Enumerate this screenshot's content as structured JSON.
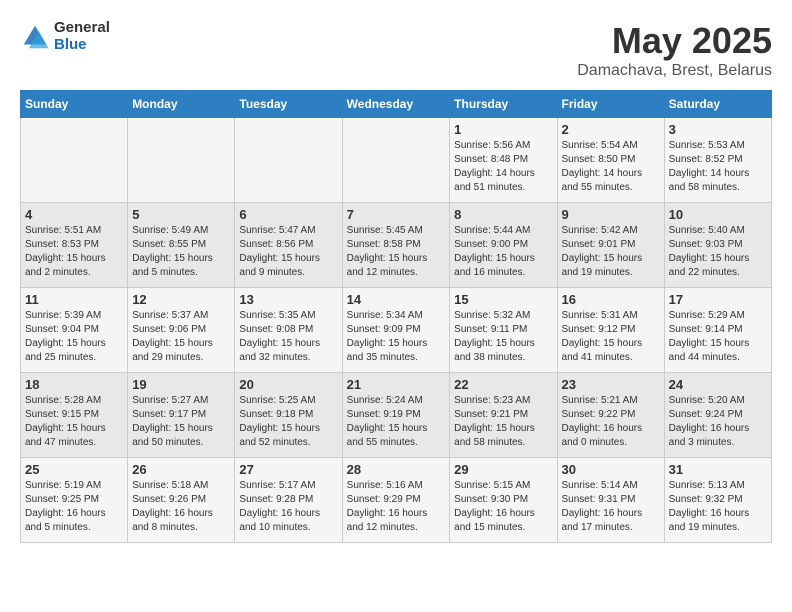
{
  "logo": {
    "general": "General",
    "blue": "Blue"
  },
  "title": "May 2025",
  "subtitle": "Damachava, Brest, Belarus",
  "headers": [
    "Sunday",
    "Monday",
    "Tuesday",
    "Wednesday",
    "Thursday",
    "Friday",
    "Saturday"
  ],
  "weeks": [
    [
      {
        "day": "",
        "sunrise": "",
        "sunset": "",
        "daylight": ""
      },
      {
        "day": "",
        "sunrise": "",
        "sunset": "",
        "daylight": ""
      },
      {
        "day": "",
        "sunrise": "",
        "sunset": "",
        "daylight": ""
      },
      {
        "day": "",
        "sunrise": "",
        "sunset": "",
        "daylight": ""
      },
      {
        "day": "1",
        "sunrise": "Sunrise: 5:56 AM",
        "sunset": "Sunset: 8:48 PM",
        "daylight": "Daylight: 14 hours and 51 minutes."
      },
      {
        "day": "2",
        "sunrise": "Sunrise: 5:54 AM",
        "sunset": "Sunset: 8:50 PM",
        "daylight": "Daylight: 14 hours and 55 minutes."
      },
      {
        "day": "3",
        "sunrise": "Sunrise: 5:53 AM",
        "sunset": "Sunset: 8:52 PM",
        "daylight": "Daylight: 14 hours and 58 minutes."
      }
    ],
    [
      {
        "day": "4",
        "sunrise": "Sunrise: 5:51 AM",
        "sunset": "Sunset: 8:53 PM",
        "daylight": "Daylight: 15 hours and 2 minutes."
      },
      {
        "day": "5",
        "sunrise": "Sunrise: 5:49 AM",
        "sunset": "Sunset: 8:55 PM",
        "daylight": "Daylight: 15 hours and 5 minutes."
      },
      {
        "day": "6",
        "sunrise": "Sunrise: 5:47 AM",
        "sunset": "Sunset: 8:56 PM",
        "daylight": "Daylight: 15 hours and 9 minutes."
      },
      {
        "day": "7",
        "sunrise": "Sunrise: 5:45 AM",
        "sunset": "Sunset: 8:58 PM",
        "daylight": "Daylight: 15 hours and 12 minutes."
      },
      {
        "day": "8",
        "sunrise": "Sunrise: 5:44 AM",
        "sunset": "Sunset: 9:00 PM",
        "daylight": "Daylight: 15 hours and 16 minutes."
      },
      {
        "day": "9",
        "sunrise": "Sunrise: 5:42 AM",
        "sunset": "Sunset: 9:01 PM",
        "daylight": "Daylight: 15 hours and 19 minutes."
      },
      {
        "day": "10",
        "sunrise": "Sunrise: 5:40 AM",
        "sunset": "Sunset: 9:03 PM",
        "daylight": "Daylight: 15 hours and 22 minutes."
      }
    ],
    [
      {
        "day": "11",
        "sunrise": "Sunrise: 5:39 AM",
        "sunset": "Sunset: 9:04 PM",
        "daylight": "Daylight: 15 hours and 25 minutes."
      },
      {
        "day": "12",
        "sunrise": "Sunrise: 5:37 AM",
        "sunset": "Sunset: 9:06 PM",
        "daylight": "Daylight: 15 hours and 29 minutes."
      },
      {
        "day": "13",
        "sunrise": "Sunrise: 5:35 AM",
        "sunset": "Sunset: 9:08 PM",
        "daylight": "Daylight: 15 hours and 32 minutes."
      },
      {
        "day": "14",
        "sunrise": "Sunrise: 5:34 AM",
        "sunset": "Sunset: 9:09 PM",
        "daylight": "Daylight: 15 hours and 35 minutes."
      },
      {
        "day": "15",
        "sunrise": "Sunrise: 5:32 AM",
        "sunset": "Sunset: 9:11 PM",
        "daylight": "Daylight: 15 hours and 38 minutes."
      },
      {
        "day": "16",
        "sunrise": "Sunrise: 5:31 AM",
        "sunset": "Sunset: 9:12 PM",
        "daylight": "Daylight: 15 hours and 41 minutes."
      },
      {
        "day": "17",
        "sunrise": "Sunrise: 5:29 AM",
        "sunset": "Sunset: 9:14 PM",
        "daylight": "Daylight: 15 hours and 44 minutes."
      }
    ],
    [
      {
        "day": "18",
        "sunrise": "Sunrise: 5:28 AM",
        "sunset": "Sunset: 9:15 PM",
        "daylight": "Daylight: 15 hours and 47 minutes."
      },
      {
        "day": "19",
        "sunrise": "Sunrise: 5:27 AM",
        "sunset": "Sunset: 9:17 PM",
        "daylight": "Daylight: 15 hours and 50 minutes."
      },
      {
        "day": "20",
        "sunrise": "Sunrise: 5:25 AM",
        "sunset": "Sunset: 9:18 PM",
        "daylight": "Daylight: 15 hours and 52 minutes."
      },
      {
        "day": "21",
        "sunrise": "Sunrise: 5:24 AM",
        "sunset": "Sunset: 9:19 PM",
        "daylight": "Daylight: 15 hours and 55 minutes."
      },
      {
        "day": "22",
        "sunrise": "Sunrise: 5:23 AM",
        "sunset": "Sunset: 9:21 PM",
        "daylight": "Daylight: 15 hours and 58 minutes."
      },
      {
        "day": "23",
        "sunrise": "Sunrise: 5:21 AM",
        "sunset": "Sunset: 9:22 PM",
        "daylight": "Daylight: 16 hours and 0 minutes."
      },
      {
        "day": "24",
        "sunrise": "Sunrise: 5:20 AM",
        "sunset": "Sunset: 9:24 PM",
        "daylight": "Daylight: 16 hours and 3 minutes."
      }
    ],
    [
      {
        "day": "25",
        "sunrise": "Sunrise: 5:19 AM",
        "sunset": "Sunset: 9:25 PM",
        "daylight": "Daylight: 16 hours and 5 minutes."
      },
      {
        "day": "26",
        "sunrise": "Sunrise: 5:18 AM",
        "sunset": "Sunset: 9:26 PM",
        "daylight": "Daylight: 16 hours and 8 minutes."
      },
      {
        "day": "27",
        "sunrise": "Sunrise: 5:17 AM",
        "sunset": "Sunset: 9:28 PM",
        "daylight": "Daylight: 16 hours and 10 minutes."
      },
      {
        "day": "28",
        "sunrise": "Sunrise: 5:16 AM",
        "sunset": "Sunset: 9:29 PM",
        "daylight": "Daylight: 16 hours and 12 minutes."
      },
      {
        "day": "29",
        "sunrise": "Sunrise: 5:15 AM",
        "sunset": "Sunset: 9:30 PM",
        "daylight": "Daylight: 16 hours and 15 minutes."
      },
      {
        "day": "30",
        "sunrise": "Sunrise: 5:14 AM",
        "sunset": "Sunset: 9:31 PM",
        "daylight": "Daylight: 16 hours and 17 minutes."
      },
      {
        "day": "31",
        "sunrise": "Sunrise: 5:13 AM",
        "sunset": "Sunset: 9:32 PM",
        "daylight": "Daylight: 16 hours and 19 minutes."
      }
    ]
  ]
}
